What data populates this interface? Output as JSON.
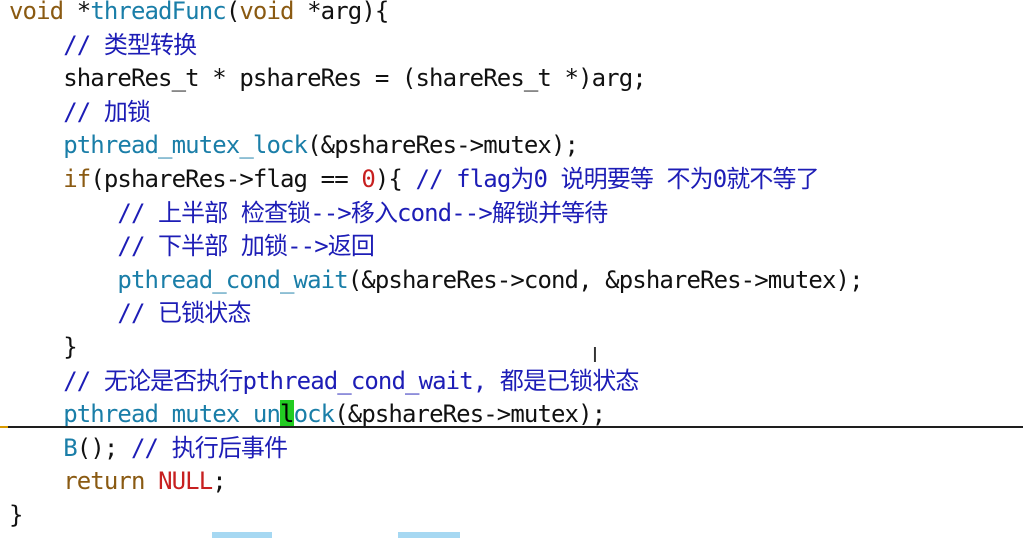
{
  "lines": [
    [
      {
        "c": "kw",
        "t": "void"
      },
      {
        "c": "plain",
        "t": " *"
      },
      {
        "c": "fn",
        "t": "threadFunc"
      },
      {
        "c": "plain",
        "t": "("
      },
      {
        "c": "kw",
        "t": "void"
      },
      {
        "c": "plain",
        "t": " *arg){"
      }
    ],
    [
      {
        "c": "cmt",
        "t": "    // 类型转换"
      }
    ],
    [
      {
        "c": "plain",
        "t": "    shareRes_t * pshareRes = (shareRes_t *)arg;"
      }
    ],
    [
      {
        "c": "cmt",
        "t": "    // 加锁"
      }
    ],
    [
      {
        "c": "plain",
        "t": "    "
      },
      {
        "c": "fn",
        "t": "pthread_mutex_lock"
      },
      {
        "c": "plain",
        "t": "(&pshareRes->mutex);"
      }
    ],
    [
      {
        "c": "plain",
        "t": "    "
      },
      {
        "c": "kw",
        "t": "if"
      },
      {
        "c": "plain",
        "t": "(pshareRes->flag == "
      },
      {
        "c": "num",
        "t": "0"
      },
      {
        "c": "plain",
        "t": "){ "
      },
      {
        "c": "cmt",
        "t": "// flag为0 说明要等 不为0就不等了"
      }
    ],
    [
      {
        "c": "cmt",
        "t": "        // 上半部 检查锁-->移入cond-->解锁并等待"
      }
    ],
    [
      {
        "c": "cmt",
        "t": "        // 下半部 加锁-->返回"
      }
    ],
    [
      {
        "c": "plain",
        "t": "        "
      },
      {
        "c": "fn",
        "t": "pthread_cond_wait"
      },
      {
        "c": "plain",
        "t": "(&pshareRes->cond, &pshareRes->mutex);"
      }
    ],
    [
      {
        "c": "cmt",
        "t": "        // 已锁状态"
      }
    ],
    [
      {
        "c": "plain",
        "t": "    }"
      }
    ],
    [
      {
        "c": "cmt",
        "t": "    // 无论是否执行pthread_cond_wait, 都是已锁状态"
      }
    ],
    [
      {
        "c": "plain",
        "t": "    "
      },
      {
        "c": "fn",
        "t": "pthread_mutex_un"
      },
      {
        "c": "caret",
        "t": "l"
      },
      {
        "c": "fn",
        "t": "ock"
      },
      {
        "c": "plain",
        "t": "(&pshareRes->mutex);"
      }
    ],
    [
      {
        "c": "plain",
        "t": "    "
      },
      {
        "c": "fn",
        "t": "B"
      },
      {
        "c": "plain",
        "t": "(); "
      },
      {
        "c": "cmt",
        "t": "// 执行后事件"
      }
    ],
    [
      {
        "c": "plain",
        "t": "    "
      },
      {
        "c": "kw",
        "t": "return"
      },
      {
        "c": "plain",
        "t": " "
      },
      {
        "c": "null",
        "t": "NULL"
      },
      {
        "c": "plain",
        "t": ";"
      }
    ],
    [
      {
        "c": "plain",
        "t": "}"
      }
    ]
  ],
  "colors": {
    "keyword": "#8a5a12",
    "function": "#1a7ea8",
    "comment": "#1d1db6",
    "number": "#c72020",
    "caret": "#22cc22"
  },
  "cursor_line": 13
}
